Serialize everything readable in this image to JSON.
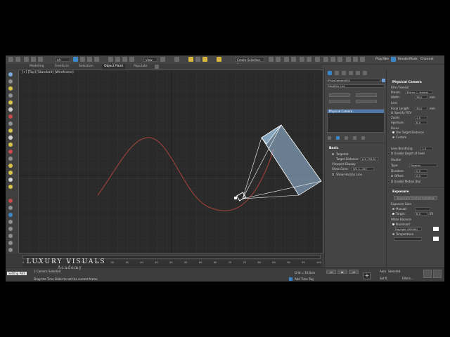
{
  "toolbar": {
    "dropdown_all": "All",
    "dropdown_view": "View",
    "selection_set": "Create Selection Set",
    "right_label_1": "Play/Ske",
    "right_label_2": "RenderMask",
    "right_label_3": "Channel",
    "colors": {
      "accent": "#3b86c8",
      "highlight": "#d6b53c"
    }
  },
  "ribbon": {
    "tabs": [
      "Modeling",
      "Freeform",
      "Selection",
      "Object Paint",
      "Populate"
    ]
  },
  "viewport": {
    "label": "[+] [Top] [Standard] [Wireframe]",
    "curve_color": "#a0423a",
    "camera_color": "#9cc4e6"
  },
  "command_panel": {
    "object_name": "PhysCamera001",
    "modifier_list": "Modifier List",
    "stack_item": "Physical Camera",
    "basic_header": "Basic",
    "targeted_label": "Targeted",
    "target_distance_label": "Target Distance:",
    "target_distance_value": "120,79120",
    "viewport_display_label": "Viewport Display",
    "show_cone_label": "Show Cone:",
    "show_cone_value": "Wh.n...ted",
    "show_horizon_label": "Show Horizon Line"
  },
  "rollout": {
    "physical_camera_header": "Physical Camera",
    "film_sensor_label": "Film / Sensor",
    "preset_label": "Preset:",
    "preset_value": "35mm (...frame)",
    "width_label": "Width:",
    "width_value": "36,0",
    "width_unit": "mm",
    "lens_label": "Lens",
    "focal_length_label": "Focal Length:",
    "focal_length_value": "30,0",
    "focal_length_unit": "mm",
    "specify_fov_label": "Specify FOV:",
    "zoom_label": "Zoom:",
    "zoom_value": "1,0",
    "aperture_label": "Aperture:",
    "aperture_value": "8,0",
    "focus_label": "Focus",
    "use_target_distance_label": "Use Target Distance",
    "custom_label": "Custom",
    "lens_breathing_label": "Lens Breathing:",
    "lens_breathing_value": "1,0",
    "enable_dof_label": "Enable Depth of Field",
    "shutter_label": "Shutter",
    "type_label": "Type:",
    "type_value": "Frames",
    "duration_label": "Duration:",
    "duration_value": "0,5",
    "offset_label": "Offset:",
    "offset_value": "0,0",
    "enable_motion_blur_label": "Enable Motion Blur",
    "exposure_header": "Exposure",
    "exposure_control_button": "Exposure Control Installed",
    "exposure_gain_label": "Exposure Gain",
    "manual_label": "Manual:",
    "target_label": "Target:",
    "target_value": "6,0",
    "target_unit": "EV",
    "white_balance_label": "White Balance",
    "illuminant_label": "Illuminant",
    "illuminant_value": "Daylight (6500K)",
    "temperature_label": "Temperature"
  },
  "timeline": {
    "ticks": [
      "0",
      "5",
      "10",
      "15",
      "20",
      "25",
      "30",
      "35",
      "40",
      "45",
      "50",
      "55",
      "60",
      "65",
      "70",
      "75",
      "80",
      "85",
      "90",
      "95",
      "100"
    ]
  },
  "status": {
    "selection_text": "1 Camera Selected",
    "prompt_text": "Drag the Time Slider to set the current frame",
    "grid_text": "Grid = 10,0cm",
    "add_time_tag": "Add Time Tag",
    "setting_path": "Setting Path",
    "auto_label": "Auto",
    "selected_label": "Selected",
    "set_k_label": "Set K.",
    "filters_label": "Filters..."
  },
  "watermark": {
    "line1": "LUXURY VISUALS",
    "line2": "Academy"
  }
}
